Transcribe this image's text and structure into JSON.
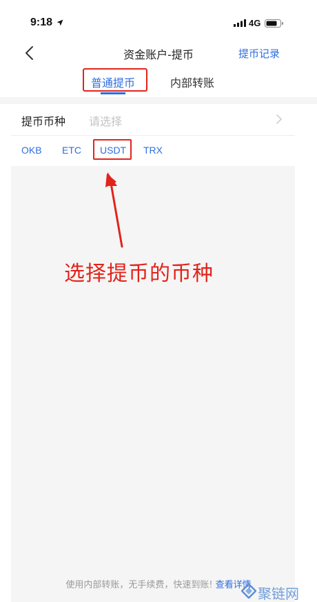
{
  "status_bar": {
    "time": "9:18",
    "network": "4G",
    "icons": [
      "location-arrow-icon",
      "signal-icon",
      "battery-icon"
    ]
  },
  "nav": {
    "title": "资金账户-提币",
    "back_icon": "chevron-left-icon",
    "action_label": "提币记录"
  },
  "tabs": [
    {
      "label": "普通提币",
      "active": true
    },
    {
      "label": "内部转账",
      "active": false
    }
  ],
  "coin_select": {
    "label": "提币币种",
    "placeholder": "请选择",
    "chevron_icon": "chevron-right-icon",
    "quick_coins": [
      "OKB",
      "ETC",
      "USDT",
      "TRX"
    ]
  },
  "annotation": {
    "text": "选择提币的币种",
    "color": "#e2231a"
  },
  "footer": {
    "text": "使用内部转账，无手续费，快速到账!",
    "link": "查看详情"
  },
  "watermark": {
    "text": "聚链网"
  },
  "colors": {
    "accent": "#2e6de0",
    "annotation": "#e2231a",
    "background_gray": "#f5f5f5"
  }
}
